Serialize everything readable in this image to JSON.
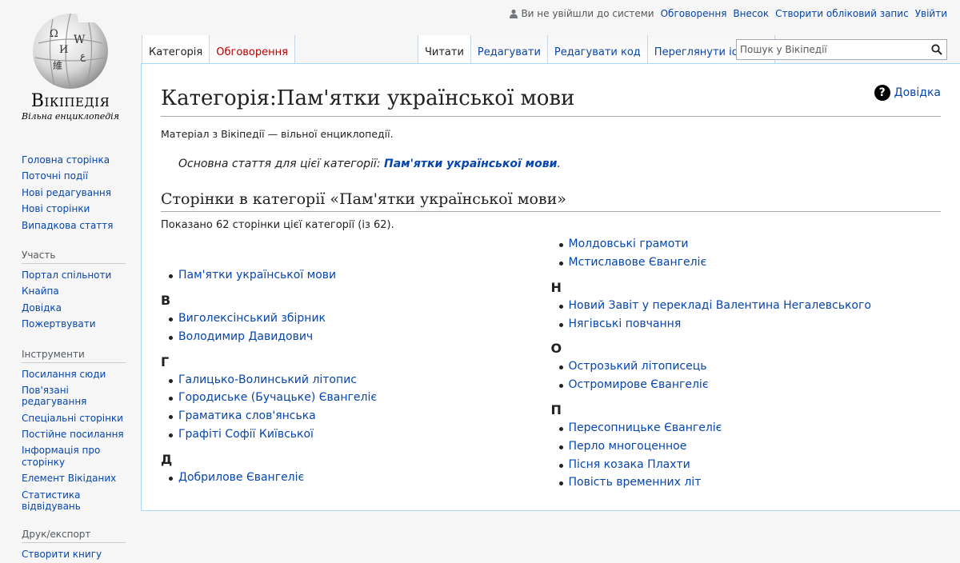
{
  "logo": {
    "wordmark": "Вікіпедія",
    "tagline": "Вільна енциклопедія"
  },
  "personal": {
    "anon_text": "Ви не увійшли до системи",
    "links": [
      "Обговорення",
      "Внесок",
      "Створити обліковий запис",
      "Увійти"
    ]
  },
  "tabs_left": [
    {
      "label": "Категорія",
      "selected": true
    },
    {
      "label": "Обговорення",
      "selected": false,
      "redlink": true
    }
  ],
  "tabs_right": [
    {
      "label": "Читати",
      "selected": true
    },
    {
      "label": "Редагувати"
    },
    {
      "label": "Редагувати код"
    },
    {
      "label": "Переглянути історію"
    }
  ],
  "search": {
    "placeholder": "Пошук у Вікіпедії"
  },
  "sidebar": {
    "navigation": [
      "Головна сторінка",
      "Поточні події",
      "Нові редагування",
      "Нові сторінки",
      "Випадкова стаття"
    ],
    "participate": {
      "title": "Участь",
      "items": [
        "Портал спільноти",
        "Кнайпа",
        "Довідка",
        "Пожертвувати"
      ]
    },
    "tools": {
      "title": "Інструменти",
      "items": [
        "Посилання сюди",
        "Пов'язані редагування",
        "Спеціальні сторінки",
        "Постійне посилання",
        "Інформація про сторінку",
        "Елемент Вікіданих",
        "Статистика відвідувань"
      ]
    },
    "print": {
      "title": "Друк/експорт",
      "items": [
        "Створити книгу"
      ]
    }
  },
  "content": {
    "help_label": "Довідка",
    "title": "Категорія:Пам'ятки української мови",
    "site_sub": "Матеріал з Вікіпедії — вільної енциклопедії.",
    "hatnote_prefix": "Основна стаття для цієї категорії: ",
    "hatnote_link": "Пам'ятки української мови",
    "hatnote_suffix": ".",
    "pages_heading": "Сторінки в категорії «Пам'ятки української мови»",
    "count_text": "Показано 62 сторінки цієї категорії (із 62)."
  },
  "col1": {
    "top": [
      "Пам'ятки української мови"
    ],
    "groups": [
      {
        "letter": "В",
        "items": [
          "Виголексінський збірник",
          "Володимир Давидович"
        ]
      },
      {
        "letter": "Г",
        "items": [
          "Галицько-Волинський літопис",
          "Городиське (Бучацьке) Євангеліє",
          "Граматика слов'янська",
          "Графіті Софії Київської"
        ]
      },
      {
        "letter": "Д",
        "items": [
          "Добрилове Євангеліє"
        ]
      }
    ]
  },
  "col2": {
    "top": [
      "Молдовські грамоти",
      "Мстиславове Євангеліє"
    ],
    "groups": [
      {
        "letter": "Н",
        "items": [
          "Новий Завіт у перекладі Валентина Негалевського",
          "Нягівські повчання"
        ]
      },
      {
        "letter": "О",
        "items": [
          "Острозький літописець",
          "Остромирове Євангеліє"
        ]
      },
      {
        "letter": "П",
        "items": [
          "Пересопницьке Євангеліє",
          "Перло многоценное",
          "Пісня козака Плахти",
          "Повість временних літ"
        ]
      }
    ]
  }
}
